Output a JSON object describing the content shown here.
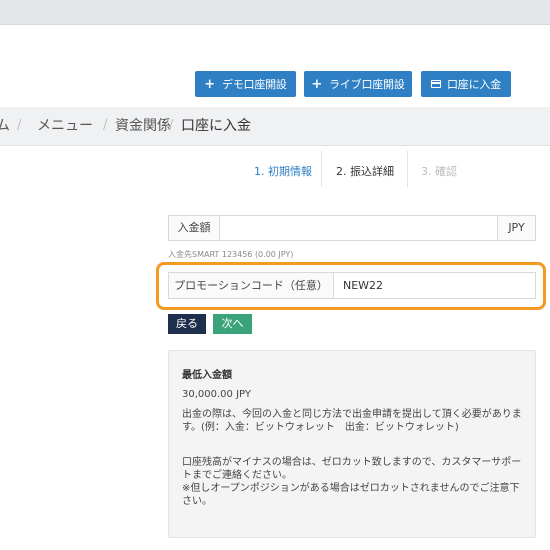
{
  "actions": {
    "demo_account": "デモ口座開設",
    "live_account": "ライブ口座開設",
    "deposit": "口座に入金"
  },
  "breadcrumb": {
    "home_fragment": "ム",
    "separator": "/",
    "menu": "メニュー",
    "funds": "資金関係",
    "current": "口座に入金"
  },
  "steps": {
    "step1": "1. 初期情報",
    "step2": "2. 振込詳細",
    "step3": "3. 確認"
  },
  "form": {
    "amount_label": "入金額",
    "amount_value": "",
    "amount_unit": "JPY",
    "deposit_target": "入金先SMART 123456 (0.00 JPY)",
    "promo_label": "プロモーションコード（任意）",
    "promo_value": "NEW22",
    "back_button": "戻る",
    "next_button": "次へ"
  },
  "info": {
    "title": "最低入金額",
    "minimum": "30,000.00 JPY",
    "p1": "出金の際は、今回の入金と同じ方法で出金申請を提出して頂く必要があります。(例：入金：ビットウォレット　出金：ビットウォレット)",
    "p2": "口座残高がマイナスの場合は、ゼロカット致しますので、カスタマーサポートまでご連絡ください。",
    "p3": "※但しオープンポジションがある場合はゼロカットされませんのでご注意下さい。"
  },
  "colors": {
    "primary": "#2e7fc3",
    "back_button": "#1e2f4e",
    "next_button": "#3aa37a",
    "highlight": "#f39a21",
    "active_step": "#333333",
    "link_step": "#2e7fc3",
    "inactive_step": "#bbbbbb"
  }
}
